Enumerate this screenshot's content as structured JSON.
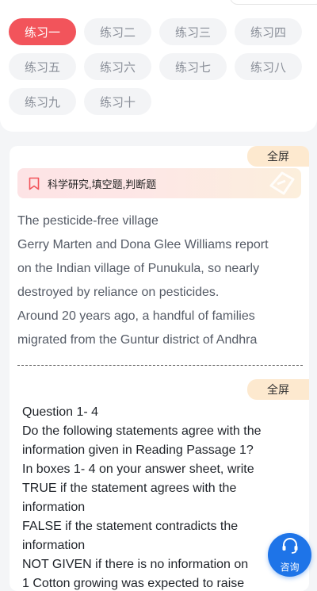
{
  "tabs": [
    {
      "label": "练习一",
      "active": true
    },
    {
      "label": "练习二"
    },
    {
      "label": "练习三"
    },
    {
      "label": "练习四"
    },
    {
      "label": "练习五"
    },
    {
      "label": "练习六"
    },
    {
      "label": "练习七"
    },
    {
      "label": "练习八"
    },
    {
      "label": "练习九"
    },
    {
      "label": "练习十"
    }
  ],
  "passage_section": {
    "fullscreen_label": "全屏",
    "tags": "科学研究,填空题,判断题",
    "lines": [
      "The pesticide-free village",
      "Gerry Marten and Dona Glee Williams report",
      "on the Indian village of Punukula, so nearly",
      "destroyed by reliance on pesticides.",
      "Around 20 years ago, a handful of families",
      "migrated from the Guntur district of Andhra"
    ]
  },
  "question_section": {
    "fullscreen_label": "全屏",
    "lines": [
      "Question 1- 4",
      "Do the following statements agree with the",
      "information given in Reading Passage 1?",
      "In boxes 1- 4 on your answer sheet, write",
      "TRUE if the statement agrees with the",
      "information",
      "FALSE if the statement contradicts the",
      "information",
      "NOT GIVEN if there is no information on",
      "1 Cotton growing was expected to raise"
    ]
  },
  "consult": {
    "label": "咨询",
    "icon": "headset-icon"
  },
  "colors": {
    "accent": "#f2545b",
    "consult": "#1e74e8",
    "fullscreen_bg": "#fde9cf"
  }
}
